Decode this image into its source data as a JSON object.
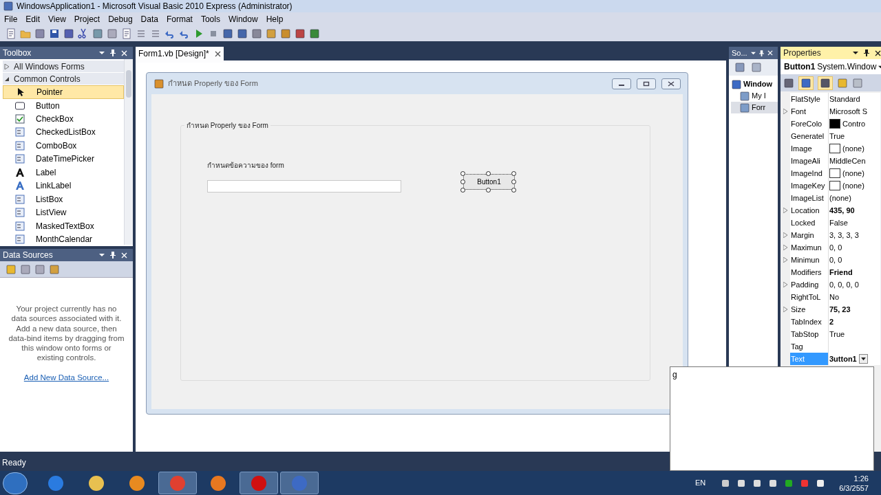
{
  "window": {
    "title": "WindowsApplication1 - Microsoft Visual Basic 2010 Express (Administrator)"
  },
  "menu": [
    "File",
    "Edit",
    "View",
    "Project",
    "Debug",
    "Data",
    "Format",
    "Tools",
    "Window",
    "Help"
  ],
  "toolbox": {
    "title": "Toolbox",
    "groups": [
      {
        "label": "All Windows Forms",
        "expanded": false
      },
      {
        "label": "Common Controls",
        "expanded": true
      }
    ],
    "items": [
      {
        "label": "Pointer",
        "selected": true
      },
      {
        "label": "Button",
        "selected": false
      },
      {
        "label": "CheckBox",
        "selected": false
      },
      {
        "label": "CheckedListBox",
        "selected": false
      },
      {
        "label": "ComboBox",
        "selected": false
      },
      {
        "label": "DateTimePicker",
        "selected": false
      },
      {
        "label": "Label",
        "selected": false
      },
      {
        "label": "LinkLabel",
        "selected": false
      },
      {
        "label": "ListBox",
        "selected": false
      },
      {
        "label": "ListView",
        "selected": false
      },
      {
        "label": "MaskedTextBox",
        "selected": false
      },
      {
        "label": "MonthCalendar",
        "selected": false
      }
    ]
  },
  "data_sources": {
    "title": "Data Sources",
    "message": "Your project currently has no data sources associated with it. Add a new data source, then data-bind items by dragging from this window onto forms or existing controls.",
    "link": "Add New Data Source..."
  },
  "document_tab": {
    "label": "Form1.vb [Design]*",
    "selected": true
  },
  "form": {
    "title": "กำหนด Properly ของ Form",
    "group_title": "กำหนด Properly ของ Form",
    "label": "กำหนดข้อความของ form",
    "button": "Button1",
    "button_selected": true
  },
  "solution_explorer": {
    "title": "So...",
    "tree": [
      {
        "label": "Window",
        "selected": false,
        "children": [
          {
            "label": "My I",
            "selected": false
          },
          {
            "label": "Forr",
            "selected": true
          }
        ]
      }
    ]
  },
  "properties": {
    "title": "Properties",
    "object_name": "Button1",
    "object_type": "System.Window",
    "rows": [
      {
        "name": "FlatStyle",
        "value": "Standard",
        "expandable": false,
        "bold": false,
        "selected": false
      },
      {
        "name": "Font",
        "value": "Microsoft S",
        "expandable": true,
        "bold": false,
        "selected": false
      },
      {
        "name": "ForeColo",
        "value": "Contro",
        "color": "#000000",
        "expandable": false,
        "bold": false,
        "selected": false
      },
      {
        "name": "Generatel",
        "value": "True",
        "expandable": false,
        "bold": false,
        "selected": false
      },
      {
        "name": "Image",
        "value": "(none)",
        "color": "#ffffff",
        "expandable": false,
        "bold": false,
        "selected": false
      },
      {
        "name": "ImageAli",
        "value": "MiddleCen",
        "expandable": false,
        "bold": false,
        "selected": false
      },
      {
        "name": "ImageInd",
        "value": "(none)",
        "color": "#ffffff",
        "expandable": false,
        "bold": false,
        "selected": false
      },
      {
        "name": "ImageKey",
        "value": "(none)",
        "color": "#ffffff",
        "expandable": false,
        "bold": false,
        "selected": false
      },
      {
        "name": "ImageList",
        "value": "(none)",
        "expandable": false,
        "bold": false,
        "selected": false
      },
      {
        "name": "Location",
        "value": "435, 90",
        "expandable": true,
        "bold": true,
        "selected": false
      },
      {
        "name": "Locked",
        "value": "False",
        "expandable": false,
        "bold": false,
        "selected": false
      },
      {
        "name": "Margin",
        "value": "3, 3, 3, 3",
        "expandable": true,
        "bold": false,
        "selected": false
      },
      {
        "name": "Maximun",
        "value": "0, 0",
        "expandable": true,
        "bold": false,
        "selected": false
      },
      {
        "name": "Minimun",
        "value": "0, 0",
        "expandable": true,
        "bold": false,
        "selected": false
      },
      {
        "name": "Modifiers",
        "value": "Friend",
        "expandable": false,
        "bold": true,
        "selected": false
      },
      {
        "name": "Padding",
        "value": "0, 0, 0, 0",
        "expandable": true,
        "bold": false,
        "selected": false
      },
      {
        "name": "RightToL",
        "value": "No",
        "expandable": false,
        "bold": false,
        "selected": false
      },
      {
        "name": "Size",
        "value": "75, 23",
        "expandable": true,
        "bold": true,
        "selected": false
      },
      {
        "name": "TabIndex",
        "value": "2",
        "expandable": false,
        "bold": true,
        "selected": false
      },
      {
        "name": "TabStop",
        "value": "True",
        "expandable": false,
        "bold": false,
        "selected": false
      },
      {
        "name": "Tag",
        "expandable": false,
        "selected": false
      },
      {
        "name": "Text",
        "value": "3utton1",
        "expandable": false,
        "bold": true,
        "selected": true,
        "dropdown": true
      }
    ]
  },
  "text_editor_popup": {
    "value": "g"
  },
  "status_bar": {
    "text": "Ready"
  },
  "taskbar": {
    "language": "EN",
    "time": "1:26",
    "date": "6/3/2557"
  }
}
